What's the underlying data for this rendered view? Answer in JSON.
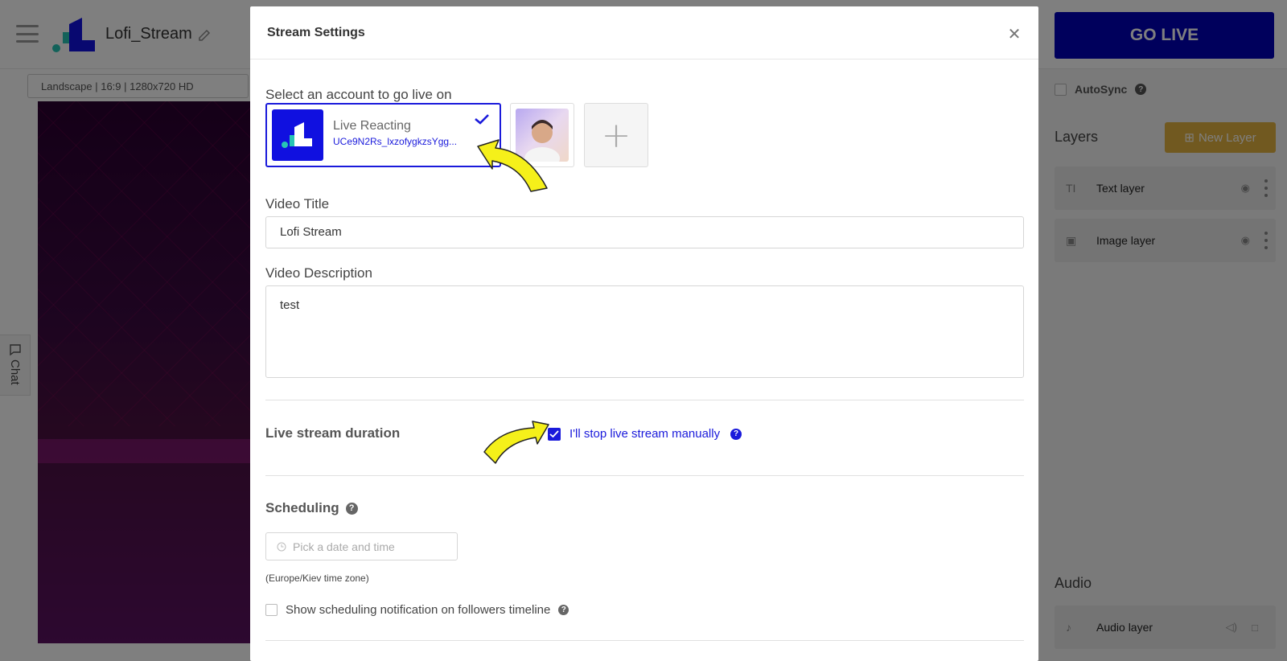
{
  "app": {
    "project_name": "Lofi_Stream",
    "resolution": "Landscape | 16:9 | 1280x720 HD",
    "go_live_label": "GO LIVE",
    "chat_label": "Chat",
    "autosync_label": "AutoSync",
    "layers_title": "Layers",
    "new_layer_label": "New Layer",
    "layers": [
      {
        "label": "Text layer",
        "icon": "text-icon"
      },
      {
        "label": "Image layer",
        "icon": "image-icon"
      }
    ],
    "audio_title": "Audio",
    "audio_layer_label": "Audio layer"
  },
  "modal": {
    "title": "Stream Settings",
    "account_section_label": "Select an account to go live on",
    "account": {
      "name": "Live Reacting",
      "id": "UCe9N2Rs_lxzofygkzsYgg..."
    },
    "video_title_label": "Video Title",
    "video_title_value": "Lofi Stream",
    "video_description_label": "Video Description",
    "video_description_value": "test",
    "duration_label": "Live stream duration",
    "manual_stop_label": "I'll stop live stream manually",
    "manual_stop_checked": true,
    "scheduling_label": "Scheduling",
    "date_placeholder": "Pick a date and time",
    "timezone": "(Europe/Kiev time zone)",
    "notify_label": "Show scheduling notification on followers timeline"
  },
  "colors": {
    "brand_blue": "#1010e0",
    "go_live_bg": "#0000b8",
    "new_layer_bg": "#e3b341",
    "annotation_arrow": "#f5f01a"
  }
}
